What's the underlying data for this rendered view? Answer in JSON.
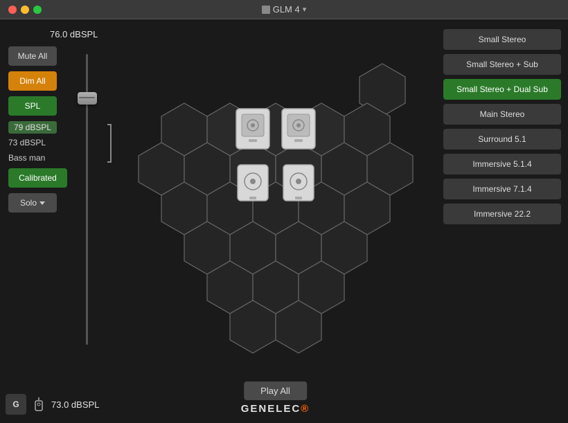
{
  "titleBar": {
    "title": "GLM 4",
    "icon": "glm-icon"
  },
  "leftPanel": {
    "splValueTop": "76.0 dBSPL",
    "muteAllLabel": "Mute All",
    "dimAllLabel": "Dim All",
    "splLabel": "SPL",
    "spl79Label": "79 dBSPL",
    "spl73Label": "73 dBSPL",
    "bassManLabel": "Bass man",
    "calibratedLabel": "Calibrated",
    "soloLabel": "Solo",
    "bottomSplLabel": "73.0 dBSPL",
    "gButtonLabel": "G"
  },
  "rightPanel": {
    "presets": [
      {
        "id": "small-stereo",
        "label": "Small Stereo",
        "active": false
      },
      {
        "id": "small-stereo-sub",
        "label": "Small Stereo + Sub",
        "active": false
      },
      {
        "id": "small-stereo-dual-sub",
        "label": "Small Stereo + Dual Sub",
        "active": true
      },
      {
        "id": "main-stereo",
        "label": "Main Stereo",
        "active": false
      },
      {
        "id": "surround-51",
        "label": "Surround 5.1",
        "active": false
      },
      {
        "id": "immersive-514",
        "label": "Immersive 5.1.4",
        "active": false
      },
      {
        "id": "immersive-714",
        "label": "Immersive 7.1.4",
        "active": false
      },
      {
        "id": "immersive-222",
        "label": "Immersive 22.2",
        "active": false
      }
    ]
  },
  "bottomCenter": {
    "playAllLabel": "Play All",
    "genelecLogo": "GENELEC"
  },
  "colors": {
    "activeGreen": "#2a7a2a",
    "dimOrange": "#d4820a",
    "darkBg": "#1a1a1a",
    "panelBg": "#2a2a2a",
    "hexStroke": "#555",
    "hexFill": "#252525"
  }
}
